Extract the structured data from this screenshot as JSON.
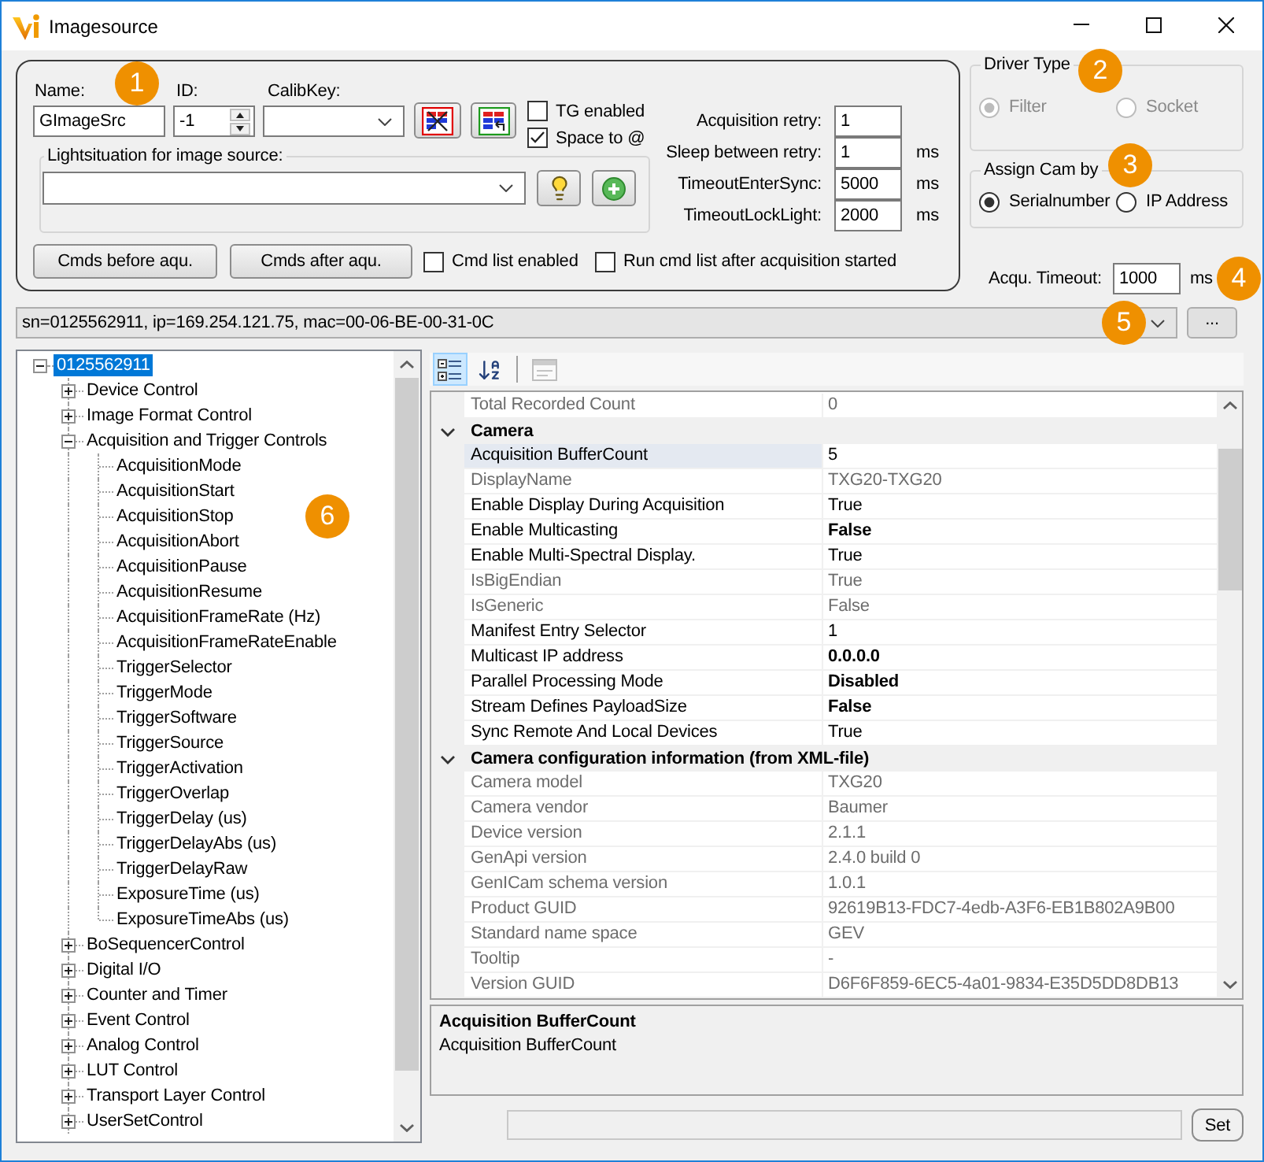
{
  "window": {
    "title": "Imagesource"
  },
  "image_source": {
    "name": {
      "label": "Name:",
      "value": "GImageSrc",
      "callout": "1"
    },
    "id": {
      "label": "ID:",
      "value": "-1"
    },
    "calib_key": {
      "label": "CalibKey:"
    },
    "checkboxes": [
      {
        "label": "TG enabled",
        "checked": false
      },
      {
        "label": "Space to @",
        "checked": true
      }
    ],
    "light_situation": {
      "title": "Lightsituation for image source:"
    },
    "command_buttons": [
      "Cmds before aqu.",
      "Cmds after aqu."
    ],
    "command_options": [
      {
        "label": "Cmd list enabled",
        "checked": false
      },
      {
        "label": "Run cmd list after acquisition started",
        "checked": false
      }
    ],
    "timing": [
      {
        "label": "Acquisition retry:",
        "value": "1"
      },
      {
        "label": "Sleep between retry:",
        "value": "1",
        "unit": "ms"
      },
      {
        "label": "TimeoutEnterSync:",
        "value": "5000",
        "unit": "ms"
      },
      {
        "label": "TimeoutLockLight:",
        "value": "2000",
        "unit": "ms"
      }
    ]
  },
  "driver_type": {
    "title": "Driver Type",
    "callout": "2",
    "options": [
      {
        "label": "Filter",
        "selected": true,
        "disabled": true
      },
      {
        "label": "Socket",
        "selected": false,
        "disabled": true
      }
    ]
  },
  "assign_cam_by": {
    "title": "Assign Cam by",
    "callout": "3",
    "options": [
      {
        "label": "Serialnumber",
        "selected": true
      },
      {
        "label": "IP Address",
        "selected": false
      }
    ]
  },
  "acquisition_timeout": {
    "label": "Acqu. Timeout:",
    "value": "1000",
    "unit": "ms",
    "callout": "4"
  },
  "device": {
    "value": "sn=0125562911, ip=169.254.121.75, mac=00-06-BE-00-31-0C",
    "callout": "5",
    "browse_button": "..."
  },
  "tree": {
    "callout": "6",
    "nodes": [
      {
        "label": "0125562911",
        "selected": true,
        "expanded": true,
        "children": [
          {
            "label": "Device Control",
            "selected": false,
            "expanded": false
          },
          {
            "label": "Image Format Control",
            "selected": false,
            "expanded": false
          },
          {
            "label": "Acquisition and Trigger Controls",
            "selected": false,
            "expanded": true,
            "children": [
              {
                "label": "AcquisitionMode",
                "selected": false
              },
              {
                "label": "AcquisitionStart",
                "selected": false
              },
              {
                "label": "AcquisitionStop",
                "selected": false
              },
              {
                "label": "AcquisitionAbort",
                "selected": false
              },
              {
                "label": "AcquisitionPause",
                "selected": false
              },
              {
                "label": "AcquisitionResume",
                "selected": false
              },
              {
                "label": "AcquisitionFrameRate (Hz)",
                "selected": false
              },
              {
                "label": "AcquisitionFrameRateEnable",
                "selected": false
              },
              {
                "label": "TriggerSelector",
                "selected": false
              },
              {
                "label": "TriggerMode",
                "selected": false
              },
              {
                "label": "TriggerSoftware",
                "selected": false
              },
              {
                "label": "TriggerSource",
                "selected": false
              },
              {
                "label": "TriggerActivation",
                "selected": false
              },
              {
                "label": "TriggerOverlap",
                "selected": false
              },
              {
                "label": "TriggerDelay (us)",
                "selected": false
              },
              {
                "label": "TriggerDelayAbs (us)",
                "selected": false
              },
              {
                "label": "TriggerDelayRaw",
                "selected": false
              },
              {
                "label": "ExposureTime (us)",
                "selected": false
              },
              {
                "label": "ExposureTimeAbs (us)",
                "selected": false
              }
            ]
          },
          {
            "label": "BoSequencerControl",
            "selected": false,
            "expanded": false
          },
          {
            "label": "Digital I/O",
            "selected": false,
            "expanded": false
          },
          {
            "label": "Counter and Timer",
            "selected": false,
            "expanded": false
          },
          {
            "label": "Event Control",
            "selected": false,
            "expanded": false
          },
          {
            "label": "Analog Control",
            "selected": false,
            "expanded": false
          },
          {
            "label": "LUT Control",
            "selected": false,
            "expanded": false
          },
          {
            "label": "Transport Layer Control",
            "selected": false,
            "expanded": false
          },
          {
            "label": "UserSetControl",
            "selected": false,
            "expanded": false
          }
        ]
      }
    ]
  },
  "property_grid": {
    "toolbar": [
      {
        "kind": "categorized",
        "selected": true,
        "disabled": false
      },
      {
        "kind": "alphabetical",
        "selected": false,
        "disabled": false
      },
      {
        "kind": "property_pages",
        "selected": false,
        "disabled": true
      }
    ],
    "rows": [
      {
        "kind": "property",
        "name": "Total Recorded Count",
        "value": "0",
        "readonly": true,
        "modified": false,
        "selected": false
      },
      {
        "kind": "category",
        "name": "Camera",
        "expanded": true
      },
      {
        "kind": "property",
        "name": "Acquisition BufferCount",
        "value": "5",
        "readonly": false,
        "modified": false,
        "selected": true
      },
      {
        "kind": "property",
        "name": "DisplayName",
        "value": "TXG20-TXG20",
        "readonly": true,
        "modified": false,
        "selected": false
      },
      {
        "kind": "property",
        "name": "Enable Display During Acquisition",
        "value": "True",
        "readonly": false,
        "modified": false,
        "selected": false
      },
      {
        "kind": "property",
        "name": "Enable Multicasting",
        "value": "False",
        "readonly": false,
        "modified": true,
        "selected": false
      },
      {
        "kind": "property",
        "name": "Enable Multi-Spectral Display.",
        "value": "True",
        "readonly": false,
        "modified": false,
        "selected": false
      },
      {
        "kind": "property",
        "name": "IsBigEndian",
        "value": "True",
        "readonly": true,
        "modified": false,
        "selected": false
      },
      {
        "kind": "property",
        "name": "IsGeneric",
        "value": "False",
        "readonly": true,
        "modified": false,
        "selected": false
      },
      {
        "kind": "property",
        "name": "Manifest Entry Selector",
        "value": "1",
        "readonly": false,
        "modified": false,
        "selected": false
      },
      {
        "kind": "property",
        "name": "Multicast IP address",
        "value": "0.0.0.0",
        "readonly": false,
        "modified": true,
        "selected": false
      },
      {
        "kind": "property",
        "name": "Parallel Processing Mode",
        "value": "Disabled",
        "readonly": false,
        "modified": true,
        "selected": false
      },
      {
        "kind": "property",
        "name": "Stream Defines PayloadSize",
        "value": "False",
        "readonly": false,
        "modified": true,
        "selected": false
      },
      {
        "kind": "property",
        "name": "Sync Remote And Local Devices",
        "value": "True",
        "readonly": false,
        "modified": false,
        "selected": false
      },
      {
        "kind": "category",
        "name": "Camera configuration information (from XML-file)",
        "expanded": true
      },
      {
        "kind": "property",
        "name": "Camera model",
        "value": "TXG20",
        "readonly": true,
        "modified": false,
        "selected": false
      },
      {
        "kind": "property",
        "name": "Camera vendor",
        "value": "Baumer",
        "readonly": true,
        "modified": false,
        "selected": false
      },
      {
        "kind": "property",
        "name": "Device version",
        "value": "2.1.1",
        "readonly": true,
        "modified": false,
        "selected": false
      },
      {
        "kind": "property",
        "name": "GenApi version",
        "value": "2.4.0 build 0",
        "readonly": true,
        "modified": false,
        "selected": false
      },
      {
        "kind": "property",
        "name": "GenICam schema version",
        "value": "1.0.1",
        "readonly": true,
        "modified": false,
        "selected": false
      },
      {
        "kind": "property",
        "name": "Product GUID",
        "value": "92619B13-FDC7-4edb-A3F6-EB1B802A9B00",
        "readonly": true,
        "modified": false,
        "selected": false
      },
      {
        "kind": "property",
        "name": "Standard name space",
        "value": "GEV",
        "readonly": true,
        "modified": false,
        "selected": false
      },
      {
        "kind": "property",
        "name": "Tooltip",
        "value": "-",
        "readonly": true,
        "modified": false,
        "selected": false
      },
      {
        "kind": "property",
        "name": "Version GUID",
        "value": "D6F6F859-6EC5-4a01-9834-E35D5DD8DB13",
        "readonly": true,
        "modified": false,
        "selected": false
      }
    ],
    "description": {
      "title": "Acquisition BufferCount",
      "text": "Acquisition BufferCount"
    },
    "command_field": {
      "disabled": true
    },
    "set_button": "Set"
  }
}
